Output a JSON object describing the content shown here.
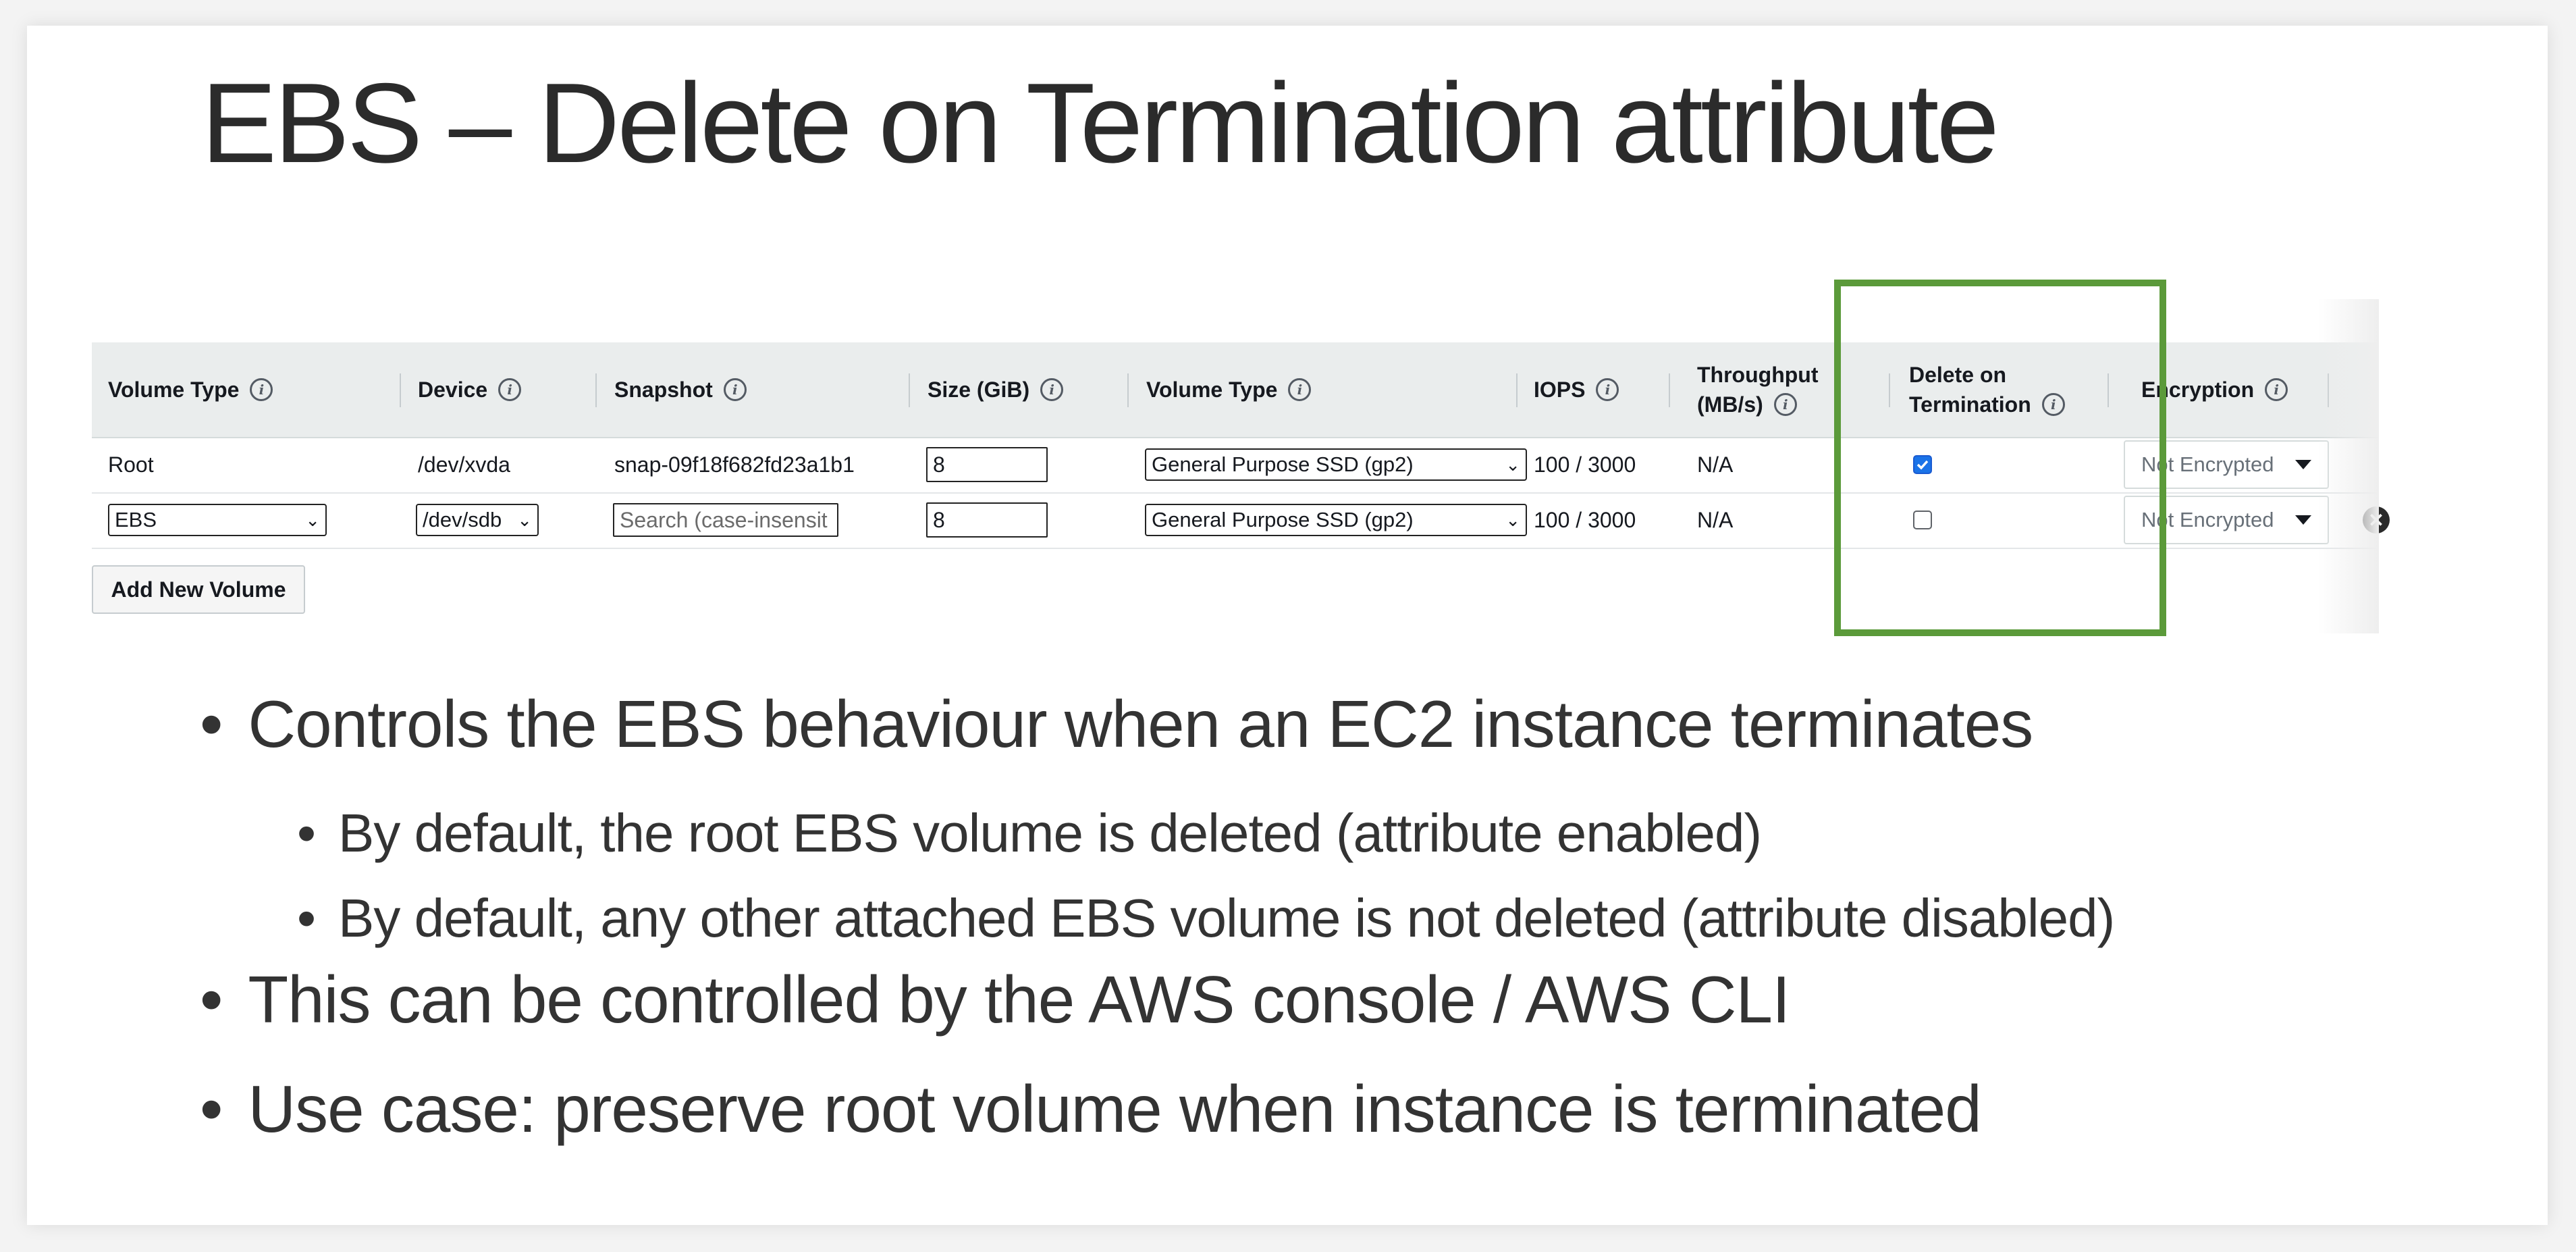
{
  "slide": {
    "title": "EBS – Delete on Termination attribute"
  },
  "table": {
    "headers": [
      {
        "label": "Volume Type"
      },
      {
        "label": "Device"
      },
      {
        "label": "Snapshot"
      },
      {
        "label": "Size (GiB)"
      },
      {
        "label": "Volume Type"
      },
      {
        "label": "IOPS"
      },
      {
        "line1": "Throughput",
        "line2": "(MB/s)"
      },
      {
        "line1": "Delete on",
        "line2": "Termination"
      },
      {
        "label": "Encryption"
      }
    ],
    "rows": [
      {
        "volume_type": "Root",
        "device": "/dev/xvda",
        "snapshot": "snap-09f18f682fd23a1b1",
        "size": "8",
        "ebs_type": "General Purpose SSD (gp2)",
        "iops": "100 / 3000",
        "throughput": "N/A",
        "delete_on_termination": true,
        "encryption": "Not Encrypted"
      },
      {
        "volume_type": "EBS",
        "device": "/dev/sdb",
        "snapshot_placeholder": "Search (case-insensit",
        "size": "8",
        "ebs_type": "General Purpose SSD (gp2)",
        "iops": "100 / 3000",
        "throughput": "N/A",
        "delete_on_termination": false,
        "encryption": "Not Encrypted"
      }
    ],
    "add_button": "Add New Volume",
    "highlight_color": "#5b9a3a",
    "checkbox_color": "#1a73e8"
  },
  "bullets": {
    "b1": "Controls the EBS behaviour when an EC2 instance terminates",
    "b1_sub1": "By default, the root EBS volume is deleted (attribute enabled)",
    "b1_sub2": "By default, any other attached EBS volume is not deleted (attribute disabled)",
    "b2": "This can be controlled by the AWS console / AWS CLI",
    "b3": "Use case: preserve root volume when instance is terminated"
  }
}
